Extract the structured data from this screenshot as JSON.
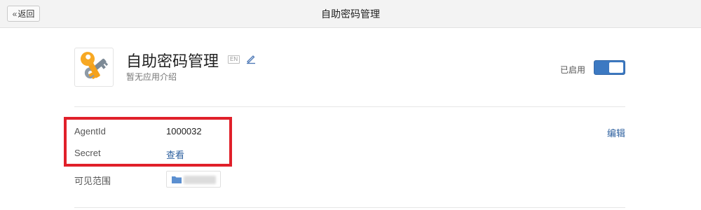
{
  "header": {
    "back_label": "返回",
    "title": "自助密码管理"
  },
  "app": {
    "name": "自助密码管理",
    "en_badge": "EN",
    "description": "暂无应用介绍",
    "icon": "key-icon",
    "status_label": "已启用",
    "enabled": true
  },
  "fields": {
    "agentid_label": "AgentId",
    "agentid_value": "1000032",
    "secret_label": "Secret",
    "secret_action": "查看",
    "scope_label": "可见范围",
    "edit_label": "编辑"
  },
  "colors": {
    "accent": "#3c79c2",
    "link": "#2c5f9e",
    "highlight": "#e0202a"
  }
}
